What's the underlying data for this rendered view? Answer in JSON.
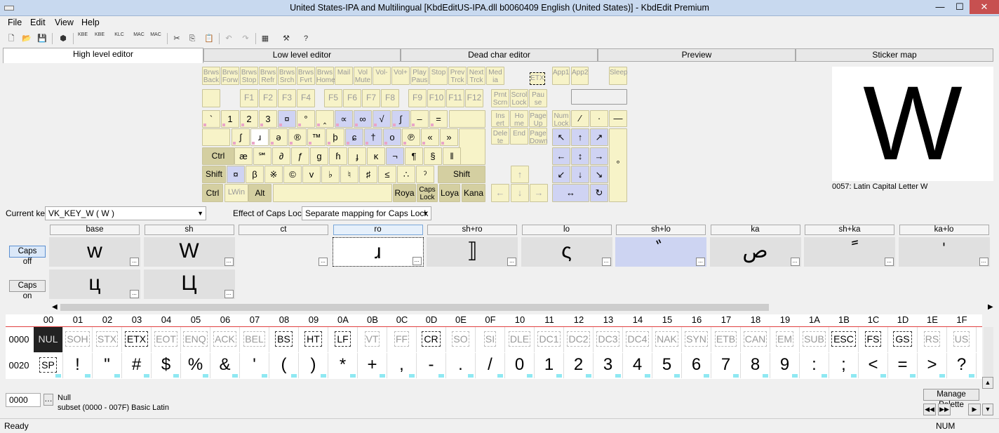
{
  "window": {
    "title": "United States-IPA and Multilingual [KbdEditUS-IPA.dll b0060409 English (United States)] - KbdEdit Premium"
  },
  "menu": [
    "File",
    "Edit",
    "View",
    "Help"
  ],
  "toolbar_icons": [
    "new-icon",
    "open-icon",
    "save-icon",
    "package-icon",
    "kbe-open-icon",
    "kbe-save-icon",
    "klc-icon",
    "mac-open-icon",
    "mac-save-icon",
    "cut-icon",
    "copy-icon",
    "paste-icon",
    "undo-icon",
    "redo-icon",
    "charmap-icon",
    "tools-icon",
    "help-icon"
  ],
  "toolbar_labels": {
    "kbe1": "KBE",
    "kbe2": "KBE",
    "klc": "KLC",
    "mac1": "MAC",
    "mac2": "MAC"
  },
  "tabs": [
    "High level editor",
    "Low level editor",
    "Dead char editor",
    "Preview",
    "Sticker map"
  ],
  "keyboard": {
    "media": [
      "Brws Back",
      "Brws Forw",
      "Brws Stop",
      "Brws Refr",
      "Brws Srch",
      "Brws Fvrt",
      "Brws Home",
      "Mail",
      "Vol Mute",
      "Vol-",
      "Vol+",
      "Play Paus",
      "Stop",
      "Prev Trck",
      "Next Trck",
      "Med ia"
    ],
    "media2": [
      "ETX",
      "App1",
      "App2",
      "Sleep"
    ],
    "fkeys": [
      "F1",
      "F2",
      "F3",
      "F4",
      "F5",
      "F6",
      "F7",
      "F8",
      "F9",
      "F10",
      "F11",
      "F12"
    ],
    "prt": [
      "Prnt Scrn",
      "Scrol Lock",
      "Pau se"
    ],
    "row1": [
      "`",
      "1",
      "2",
      "3",
      "¤",
      "°",
      "‸",
      "∝",
      "∞",
      "√",
      "∫",
      "–",
      "="
    ],
    "row2": [
      "",
      "ʃ",
      "ɹ",
      "ə",
      "®",
      "™",
      "þ",
      "ɕ",
      "†",
      "o",
      "℗",
      "«",
      "»"
    ],
    "row3": [
      "Ctrl",
      "æ",
      "℠",
      "∂",
      "ƒ",
      "ɡ",
      "ɦ",
      "ɟ",
      "ĸ",
      "¬",
      "¶",
      "§",
      "‖"
    ],
    "row4": [
      "Shift",
      "¤",
      "β",
      "※",
      "©",
      "v",
      "♭",
      "♮",
      "♯",
      "≤",
      "∴",
      "ˀ",
      "Shift"
    ],
    "row5": [
      "Ctrl",
      "LWin",
      "Alt",
      "",
      "Roya",
      "Caps Lock",
      "Loya",
      "Kana"
    ],
    "nav": [
      "Ins ert",
      "Ho me",
      "Page Up",
      "Dele te",
      "End",
      "Page Down"
    ],
    "arrows": [
      "↑",
      "←",
      "↓",
      "→"
    ],
    "numpad": [
      "Num Lock",
      "∕",
      "·",
      "—",
      "↖",
      "↑",
      "↗",
      "←",
      "↕",
      "→",
      "↙",
      "↓",
      "↘",
      "↔",
      "↻",
      "°"
    ]
  },
  "preview": {
    "glyph": "W",
    "caption": "0057: Latin Capital Letter W"
  },
  "current_key": {
    "label": "Current key",
    "value": "VK_KEY_W ( W )"
  },
  "caps": {
    "label": "Effect of Caps Lock",
    "value": "Separate mapping for Caps Lock"
  },
  "shift_states": [
    "base",
    "sh",
    "ct",
    "ro",
    "sh+ro",
    "lo",
    "sh+lo",
    "ka",
    "sh+ka",
    "ka+lo"
  ],
  "caps_off": {
    "label": "Caps off",
    "values": [
      "w",
      "W",
      "",
      "ɹ",
      "⟧",
      "ς",
      "ﾞ",
      "ص",
      "ً",
      "ˈ"
    ]
  },
  "caps_on": {
    "label": "Caps on",
    "values": [
      "ц",
      "Ц"
    ]
  },
  "char_table": {
    "cols": [
      "00",
      "01",
      "02",
      "03",
      "04",
      "05",
      "06",
      "07",
      "08",
      "09",
      "0A",
      "0B",
      "0C",
      "0D",
      "0E",
      "0F",
      "10",
      "11",
      "12",
      "13",
      "14",
      "15",
      "16",
      "17",
      "18",
      "19",
      "1A",
      "1B",
      "1C",
      "1D",
      "1E",
      "1F"
    ],
    "row_labels": [
      "0000",
      "0020"
    ],
    "row0": [
      "NUL",
      "SOH",
      "STX",
      "ETX",
      "EOT",
      "ENQ",
      "ACK",
      "BEL",
      "BS",
      "HT",
      "LF",
      "VT",
      "FF",
      "CR",
      "SO",
      "SI",
      "DLE",
      "DC1",
      "DC2",
      "DC3",
      "DC4",
      "NAK",
      "SYN",
      "ETB",
      "CAN",
      "EM",
      "SUB",
      "ESC",
      "FS",
      "GS",
      "RS",
      "US"
    ],
    "row1": [
      "SP",
      "!",
      "\"",
      "#",
      "$",
      "%",
      "&",
      "'",
      "(",
      ")",
      "*",
      "+",
      ",",
      "-",
      ".",
      "/",
      "0",
      "1",
      "2",
      "3",
      "4",
      "5",
      "6",
      "7",
      "8",
      "9",
      ":",
      ";",
      "<",
      "=",
      ">",
      "?"
    ]
  },
  "bottom": {
    "code": "0000",
    "name": "Null",
    "subset": "subset (0000 - 007F) Basic Latin",
    "manage": "Manage Palette"
  },
  "status": {
    "left": "Ready",
    "num": "NUM"
  }
}
